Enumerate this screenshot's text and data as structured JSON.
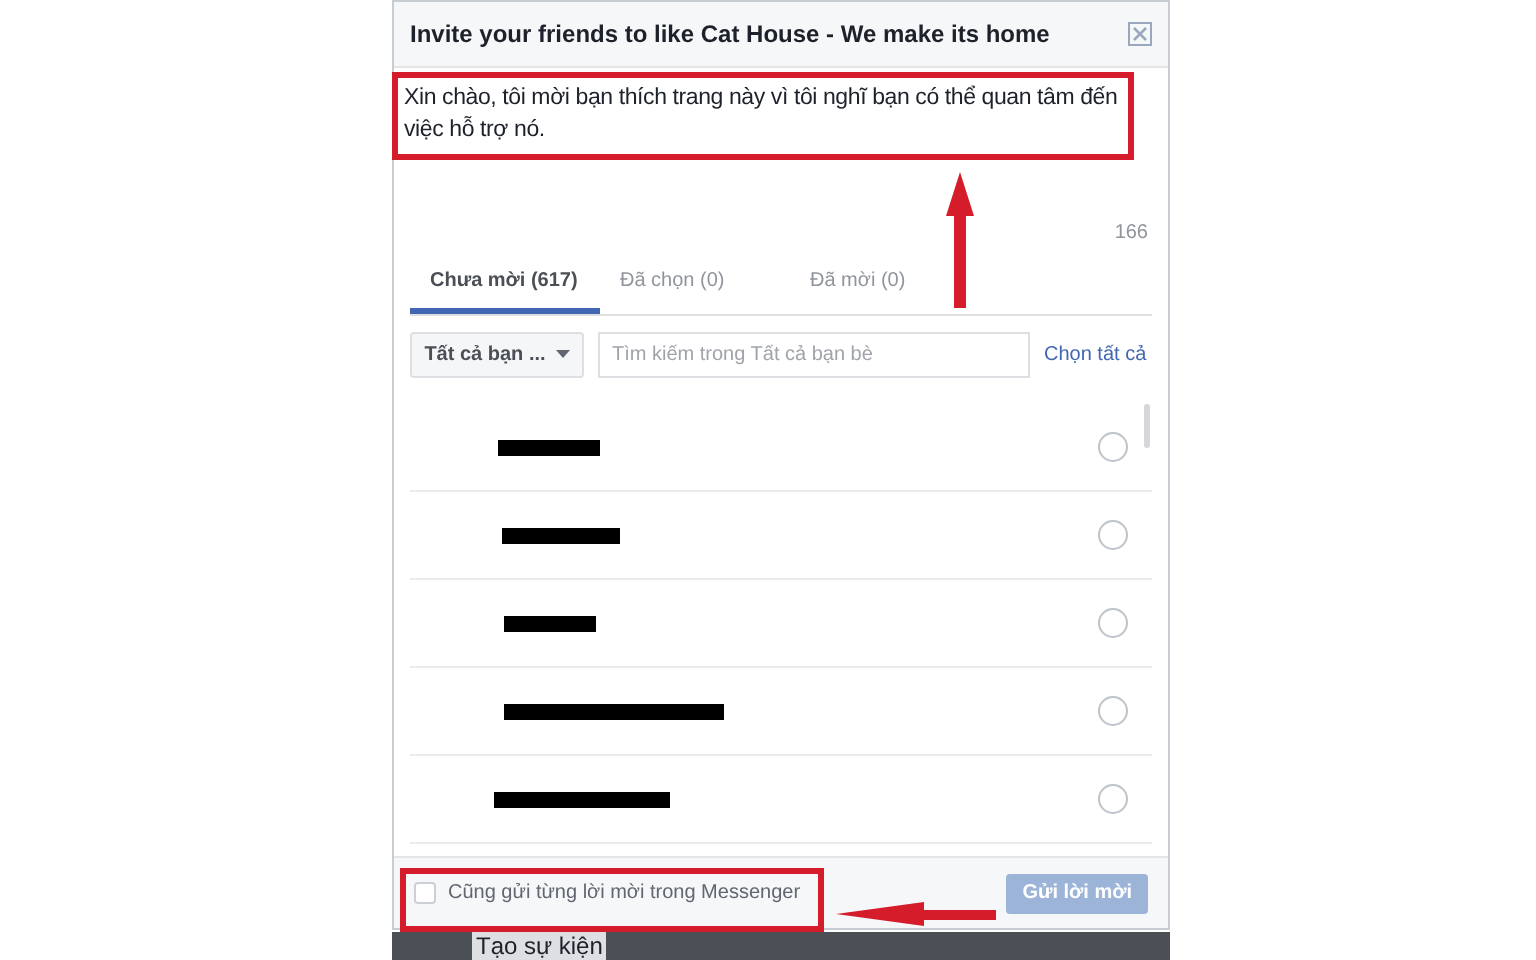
{
  "dialog": {
    "title": "Invite your friends to like Cat House - We make its home",
    "message": "Xin chào, tôi mời bạn thích trang này vì tôi nghĩ bạn có thể quan tâm đến việc hỗ trợ nó.",
    "char_count": "166"
  },
  "tabs": [
    {
      "label": "Chưa mời (617)",
      "selected": true
    },
    {
      "label": "Đã chọn (0)",
      "selected": false
    },
    {
      "label": "Đã mời (0)",
      "selected": false
    }
  ],
  "filter": {
    "dropdown": "Tất cả bạn ...",
    "search_placeholder": "Tìm kiếm trong Tất cả bạn bè",
    "select_all": "Chọn tất cả"
  },
  "friends": [
    {
      "selected": false
    },
    {
      "selected": false
    },
    {
      "selected": false
    },
    {
      "selected": false
    },
    {
      "selected": false
    }
  ],
  "footer": {
    "messenger_label": "Cũng gửi từng lời mời trong Messenger",
    "messenger_checked": false,
    "send_button": "Gửi lời mời",
    "send_disabled": true
  },
  "background_text": "Tạo sự kiện"
}
